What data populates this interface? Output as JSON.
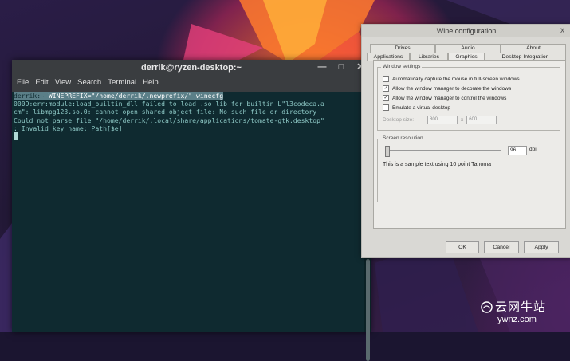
{
  "terminal": {
    "title": "derrik@ryzen-desktop:~",
    "menu": [
      "File",
      "Edit",
      "View",
      "Search",
      "Terminal",
      "Help"
    ],
    "window_buttons": [
      "minimize",
      "maximize",
      "close"
    ],
    "prompt": "derrik:~",
    "command": " WINEPREFIX=\"/home/derrik/.newprefix/\" winecfg",
    "output_lines": [
      "0009:err:module:load_builtin_dll failed to load .so lib for builtin L\"l3codeca.a",
      "cm\": libmpg123.so.0: cannot open shared object file: No such file or directory",
      "Could not parse file \"/home/derrik/.local/share/applications/tomate-gtk.desktop\"",
      ": Invalid key name: Path[$e]"
    ]
  },
  "wine": {
    "title": "Wine configuration",
    "close_glyph": "x",
    "tabs_top": [
      "Drives",
      "Audio",
      "About"
    ],
    "tabs_bottom": [
      "Applications",
      "Libraries",
      "Graphics",
      "Desktop Integration"
    ],
    "active_tab": "Graphics",
    "window_settings": {
      "title": "Window settings",
      "options": [
        {
          "label": "Automatically capture the mouse in full-screen windows",
          "checked": false
        },
        {
          "label": "Allow the window manager to decorate the windows",
          "checked": true
        },
        {
          "label": "Allow the window manager to control the windows",
          "checked": true
        },
        {
          "label": "Emulate a virtual desktop",
          "checked": false
        }
      ],
      "desktop_size_label": "Desktop size:",
      "desktop_width": "800",
      "desktop_x": "x",
      "desktop_height": "600"
    },
    "screen_resolution": {
      "title": "Screen resolution",
      "dpi_value": "96",
      "dpi_unit": "dpi",
      "sample_text": "This is a sample text using 10 point Tahoma"
    },
    "buttons": [
      "OK",
      "Cancel",
      "Apply"
    ]
  },
  "watermark": {
    "text_cn": "云网牛站",
    "url": "ywnz.com"
  }
}
